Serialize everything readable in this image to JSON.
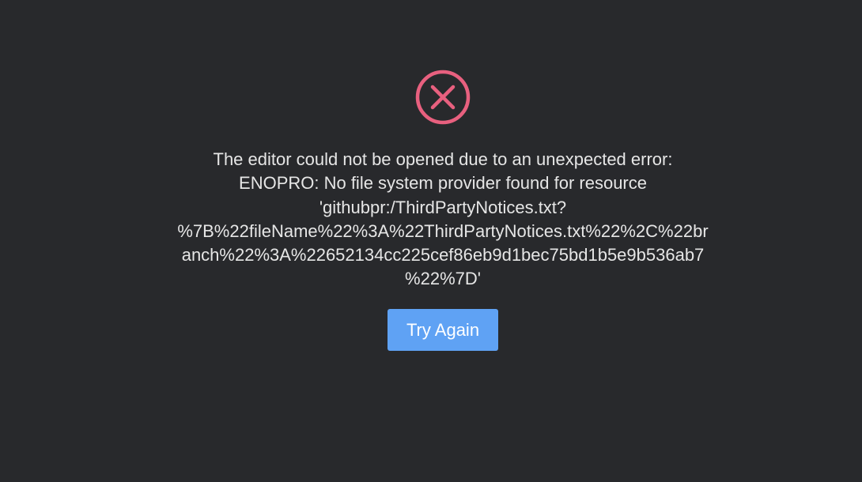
{
  "theme": {
    "background": "#28292c",
    "text_color": "#e6e6e6",
    "error_accent": "#e8607f",
    "button_color": "#5fa2f4",
    "button_text_color": "#ffffff"
  },
  "error": {
    "icon": "error-circle-x-icon",
    "message_lines": [
      "The editor could not be opened due to an unexpected error:",
      "ENOPRO: No file system provider found for resource",
      "'githubpr:/ThirdPartyNotices.txt?",
      "%7B%22fileName%22%3A%22ThirdPartyNotices.txt%22%2C%22br",
      "anch%22%3A%22652134cc225cef86eb9d1bec75bd1b5e9b536ab7",
      "%22%7D'"
    ]
  },
  "actions": {
    "try_again_label": "Try Again"
  }
}
